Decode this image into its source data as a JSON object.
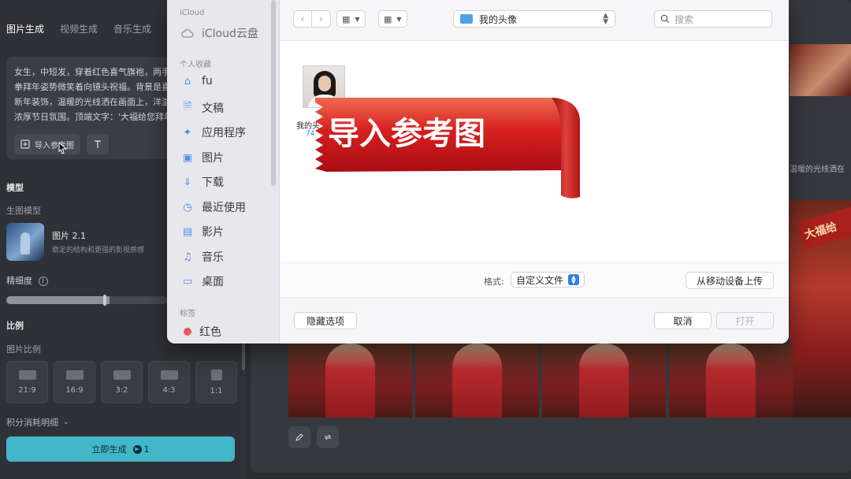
{
  "app": {
    "tabs": [
      {
        "label": "图片生成",
        "active": true
      },
      {
        "label": "视频生成",
        "active": false
      },
      {
        "label": "音乐生成",
        "active": false
      }
    ],
    "prompt": {
      "text": "女生，中短发，穿着红色喜气旗袍，两手抱拳拜年姿势微笑着向镜头祝福。背景是喜庆新年装饰，温暖的光线洒在画面上，洋溢着浓厚节日氛围。顶端文字：'大福给您拜年啦'。",
      "import_label": "导入参考图"
    },
    "model_section": {
      "title": "模型",
      "subtitle": "生图模型"
    },
    "model": {
      "name": "图片 2.1",
      "description": "稳定的结构和更强的影视质感"
    },
    "precision": {
      "label": "精细度",
      "value": 0.64
    },
    "ratio_section": {
      "title": "比例",
      "subtitle": "图片比例"
    },
    "ratios": [
      "21:9",
      "16:9",
      "3:2",
      "4:3",
      "1:1"
    ],
    "credits_label": "积分消耗明细",
    "generate": {
      "label": "立即生成",
      "cost": "1"
    }
  },
  "right": {
    "caption_fragment": "温暖的光线洒在",
    "sign_text": "大福给"
  },
  "dialog": {
    "sidebar": {
      "icloud_header": "iCloud",
      "icloud_item": "iCloud云盘",
      "favorites_header": "个人收藏",
      "favorites": [
        {
          "label": "fu",
          "icon": "home-icon"
        },
        {
          "label": "文稿",
          "icon": "document-icon"
        },
        {
          "label": "应用程序",
          "icon": "apps-icon"
        },
        {
          "label": "图片",
          "icon": "photo-icon"
        },
        {
          "label": "下载",
          "icon": "download-icon"
        },
        {
          "label": "最近使用",
          "icon": "clock-icon"
        },
        {
          "label": "影片",
          "icon": "film-icon"
        },
        {
          "label": "音乐",
          "icon": "music-icon"
        },
        {
          "label": "桌面",
          "icon": "desktop-icon"
        }
      ],
      "tags_header": "标签",
      "tags": [
        {
          "label": "红色",
          "color": "#e85b5b"
        }
      ]
    },
    "location": "我的头像",
    "search_placeholder": "搜索",
    "file": {
      "name": "我的头",
      "size": "74"
    },
    "banner_text": "导入参考图",
    "format_label": "格式:",
    "format_value": "自定义文件",
    "mobile_upload": "从移动设备上传",
    "hide_options": "隐藏选项",
    "cancel": "取消",
    "open": "打开"
  }
}
